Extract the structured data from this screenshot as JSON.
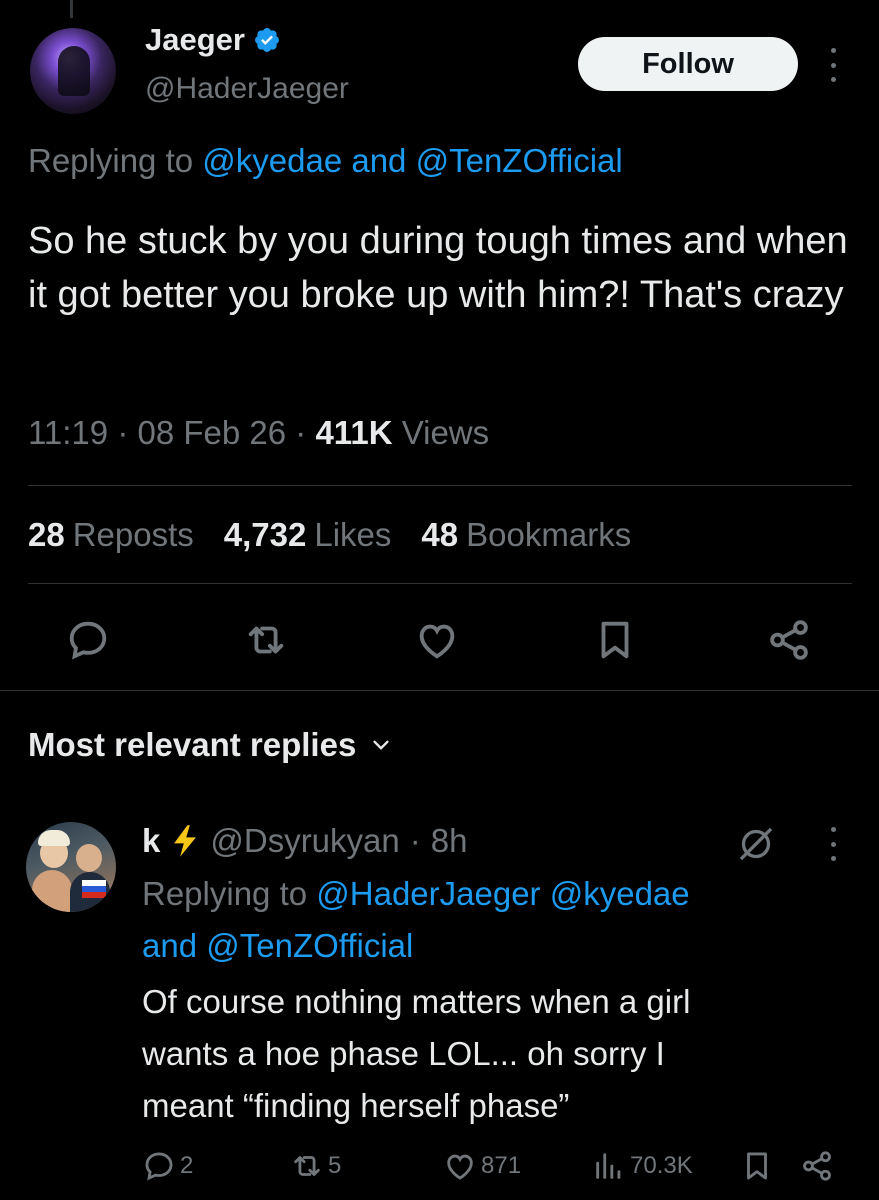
{
  "tweet": {
    "author_name": "Jaeger",
    "author_handle": "@HaderJaeger",
    "follow_label": "Follow",
    "replying_prefix": "Replying to ",
    "replying_user1": "@kyedae",
    "replying_and": " and ",
    "replying_user2": "@TenZOfficial",
    "text": "So he stuck by you during tough times and when it got better you broke up with him?! That's crazy",
    "time": "11:19",
    "date": "08 Feb 26",
    "sep": "·",
    "views_count": "411K",
    "views_label": "Views",
    "reposts_count": "28",
    "reposts_label": "Reposts",
    "likes_count": "4,732",
    "likes_label": "Likes",
    "bookmarks_count": "48",
    "bookmarks_label": "Bookmarks"
  },
  "replies_header": {
    "label": "Most relevant replies"
  },
  "reply": {
    "author_name": "k",
    "author_handle": "@Dsyrukyan",
    "age": "8h",
    "replying_prefix": "Replying to ",
    "replying_user1": "@HaderJaeger",
    "replying_user2": "@kyedae",
    "replying_and": "and",
    "replying_user3": "@TenZOfficial",
    "text_line1": "Of course nothing matters when a girl",
    "text_line2": "wants a hoe phase LOL... oh sorry I",
    "text_line3": "meant “finding herself phase”",
    "reply_count": "2",
    "repost_count": "5",
    "like_count": "871",
    "view_count": "70.3K"
  },
  "colors": {
    "accent": "#1d9bf0",
    "text": "#e7e9ea",
    "muted": "#71767b",
    "background": "#000000",
    "bolt": "#f5c518"
  },
  "icons": [
    "verified-badge-icon",
    "more-icon",
    "reply-icon",
    "repost-icon",
    "like-icon",
    "bookmark-icon",
    "share-icon",
    "chevron-down-icon",
    "lightning-icon",
    "hide-reply-icon",
    "views-icon"
  ]
}
